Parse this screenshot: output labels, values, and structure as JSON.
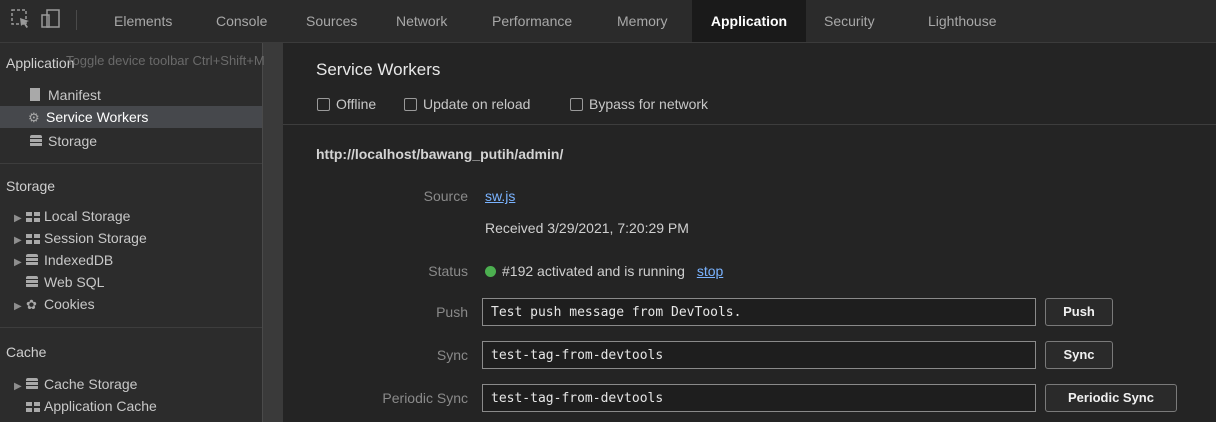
{
  "toolbar": {
    "tabs": [
      "Elements",
      "Console",
      "Sources",
      "Network",
      "Performance",
      "Memory",
      "Application",
      "Security",
      "Lighthouse"
    ],
    "active_tab": "Application"
  },
  "tooltip": "Toggle device toolbar  Ctrl+Shift+M",
  "sidebar": {
    "sections": {
      "application": {
        "title": "Application",
        "items": [
          "Manifest",
          "Service Workers",
          "Storage"
        ]
      },
      "storage": {
        "title": "Storage",
        "items": [
          "Local Storage",
          "Session Storage",
          "IndexedDB",
          "Web SQL",
          "Cookies"
        ]
      },
      "cache": {
        "title": "Cache",
        "items": [
          "Cache Storage",
          "Application Cache"
        ]
      }
    },
    "selected": "Service Workers"
  },
  "main": {
    "title": "Service Workers",
    "options": [
      "Offline",
      "Update on reload",
      "Bypass for network"
    ],
    "scope_url": "http://localhost/bawang_putih/admin/",
    "labels": {
      "source": "Source",
      "status": "Status",
      "push": "Push",
      "sync": "Sync",
      "periodic_sync": "Periodic Sync"
    },
    "source_file": "sw.js",
    "received": "Received 3/29/2021, 7:20:29 PM",
    "status_text": "#192 activated and is running",
    "status_link": "stop",
    "status_color": "#4caf50",
    "push_value": "Test push message from DevTools.",
    "sync_value": "test-tag-from-devtools",
    "periodic_sync_value": "test-tag-from-devtools",
    "buttons": {
      "push": "Push",
      "sync": "Sync",
      "periodic_sync": "Periodic Sync"
    }
  }
}
